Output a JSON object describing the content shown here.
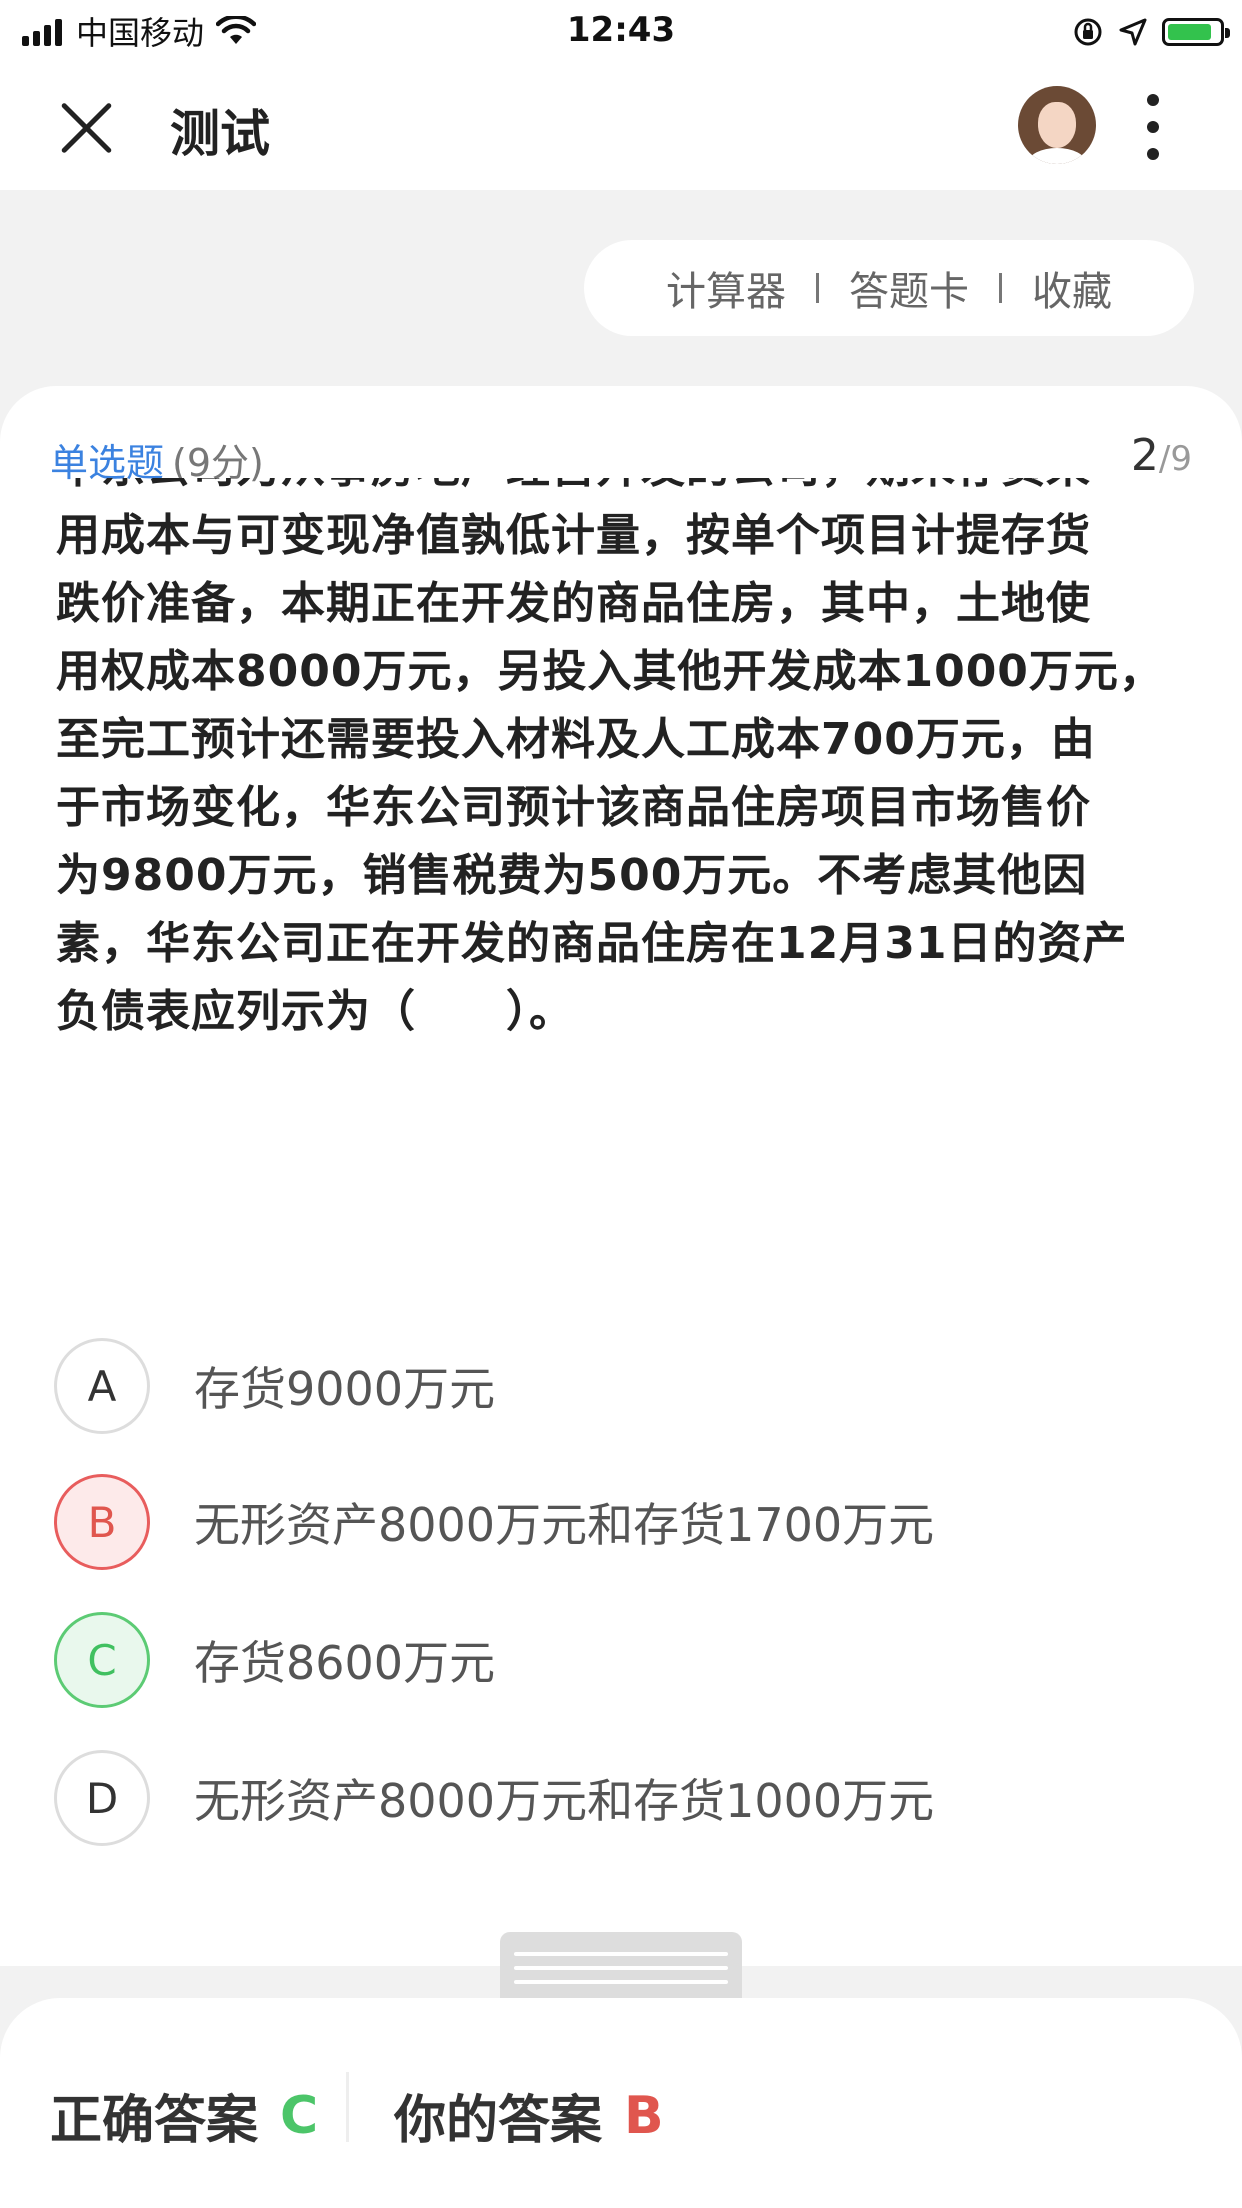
{
  "status_bar": {
    "carrier": "中国移动",
    "time": "12:43",
    "icons": [
      "signal-icon",
      "wifi-icon",
      "orientation-lock-icon",
      "location-icon",
      "battery-charging-icon"
    ]
  },
  "nav": {
    "title": "测试",
    "close_icon": "close-icon",
    "more_icon": "more-vertical-icon"
  },
  "tools": {
    "calculator": "计算器",
    "answer_card": "答题卡",
    "favorite": "收藏"
  },
  "question": {
    "type": "单选题",
    "score": "(9分)",
    "current": "2",
    "total": "/9",
    "lines": [
      "华东公司为从事房地产经营开发的公司，期末存货采",
      "用成本与可变现净值孰低计量，按单个项目计提存货",
      "跌价准备，本期正在开发的商品住房，其中，土地使",
      "用权成本8000万元，另投入其他开发成本1000万元，",
      "至完工预计还需要投入材料及人工成本700万元，由",
      "于市场变化，华东公司预计该商品住房项目市场售价",
      "为9800万元，销售税费为500万元。不考虑其他因",
      "素，华东公司正在开发的商品住房在12月31日的资产",
      "负债表应列示为（　　）。"
    ]
  },
  "options": [
    {
      "letter": "A",
      "text": "存货9000万元"
    },
    {
      "letter": "B",
      "text": "无形资产8000万元和存货1700万元"
    },
    {
      "letter": "C",
      "text": "存货8600万元"
    },
    {
      "letter": "D",
      "text": "无形资产8000万元和存货1000万元"
    }
  ],
  "answers": {
    "correct_label": "正确答案",
    "correct": "C",
    "yours_label": "你的答案",
    "yours": "B"
  },
  "colors": {
    "accent_blue": "#3b82e0",
    "correct_green": "#40c060",
    "wrong_red": "#e0564e"
  }
}
